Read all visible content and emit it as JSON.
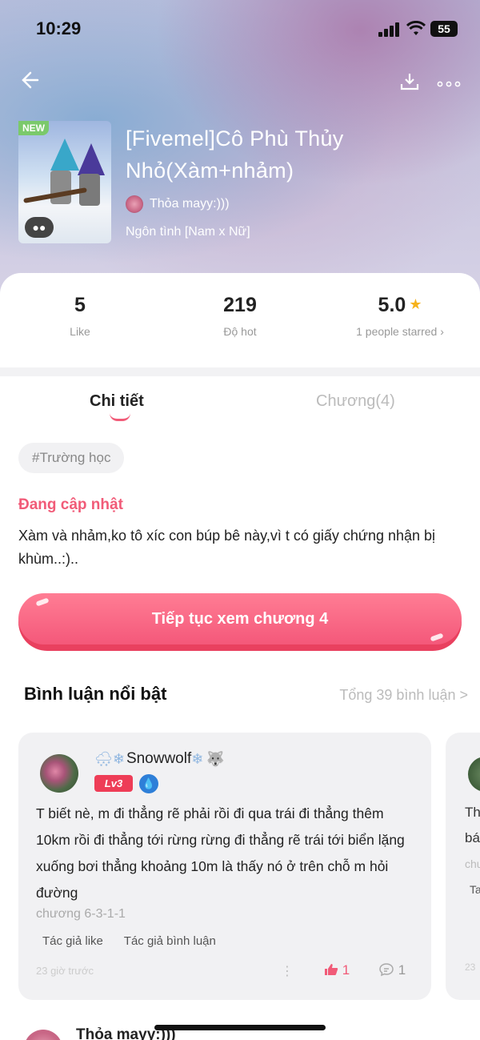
{
  "status_bar": {
    "time": "10:29",
    "battery": "55"
  },
  "nav": {
    "back_icon": "back-arrow-icon",
    "download_icon": "download-icon",
    "more_icon": "more-icon"
  },
  "book": {
    "badge": "NEW",
    "title": "[Fivemel]Cô Phù Thủy Nhỏ(Xàm+nhảm)",
    "author": "Thỏa mayy:)))",
    "genre": "Ngôn tình [Nam x Nữ]"
  },
  "stats": [
    {
      "value": "5",
      "label": "Like"
    },
    {
      "value": "219",
      "label": "Độ hot"
    },
    {
      "value": "5.0",
      "label": "1 people starred ›"
    }
  ],
  "tabs": [
    {
      "label": "Chi tiết",
      "active": true
    },
    {
      "label": "Chương(4)",
      "active": false
    }
  ],
  "tag": "#Trường học",
  "update_status": "Đang cập nhật",
  "description": "Xàm và nhảm,ko tô xíc con búp bê này,vì t có giấy chứng nhận bị khùm..:)..",
  "cta": {
    "label": "Tiếp tục xem chương 4"
  },
  "comments_section": {
    "title": "Bình luận nổi bật",
    "total": "Tổng 39 bình luận >"
  },
  "comments": [
    {
      "username": "Snowwolf",
      "level": "Lv3",
      "text": "T biết nè, m đi thẳng rẽ phải rồi đi qua trái đi thẳng thêm 10km rồi đi thẳng tới rừng rừng đi thẳng rẽ trái tới biển lặng xuống bơi thẳng khoảng 10m là thấy nó ở trên chỗ m hỏi đường",
      "chapter": "chương 6-3-1-1",
      "tags": [
        "Tác giả like",
        "Tác giả bình luận"
      ],
      "time": "23 giờ trước",
      "likes": "1",
      "replies": "1"
    }
  ],
  "partial_card": {
    "line1": "Th",
    "line2": "bá",
    "line3": "chư",
    "line4": "Ta",
    "time": "23"
  },
  "next_comment_author": "Thỏa mayy:)))"
}
